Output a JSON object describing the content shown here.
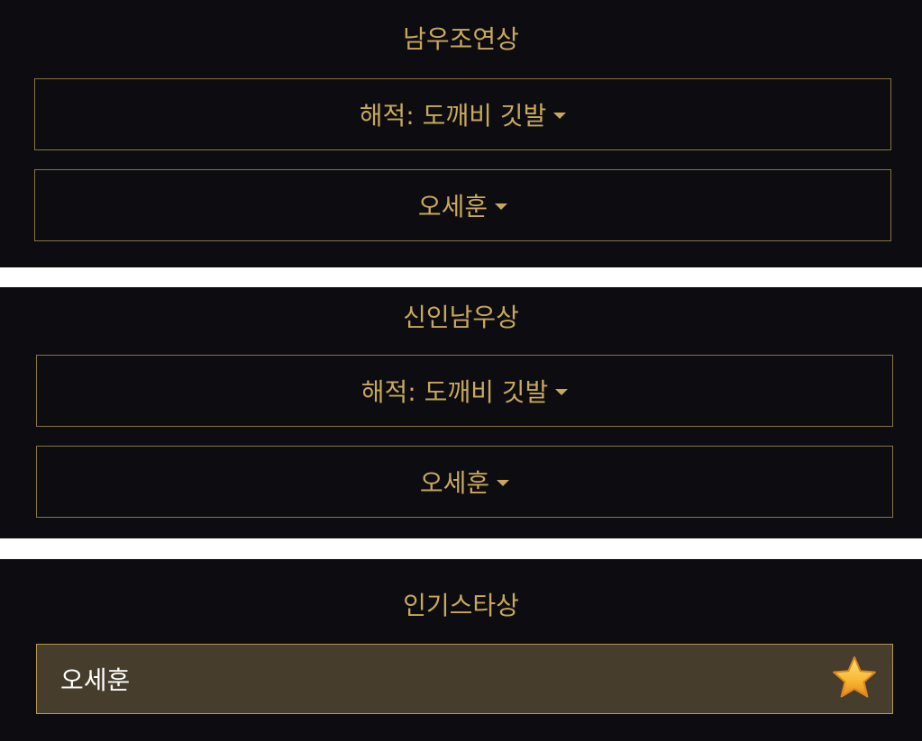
{
  "sections": [
    {
      "title": "남우조연상",
      "award_dropdown": "해적: 도깨비 깃발",
      "person_dropdown": "오세훈"
    },
    {
      "title": "신인남우상",
      "award_dropdown": "해적: 도깨비 깃발",
      "person_dropdown": "오세훈"
    },
    {
      "title": "인기스타상",
      "selected_person": "오세훈",
      "icon": "star-icon"
    }
  ],
  "colors": {
    "panel_background": "#0c0c11",
    "accent_gold": "#c9a85a",
    "selected_row_background": "#463d2c",
    "divider_white": "#ffffff"
  }
}
